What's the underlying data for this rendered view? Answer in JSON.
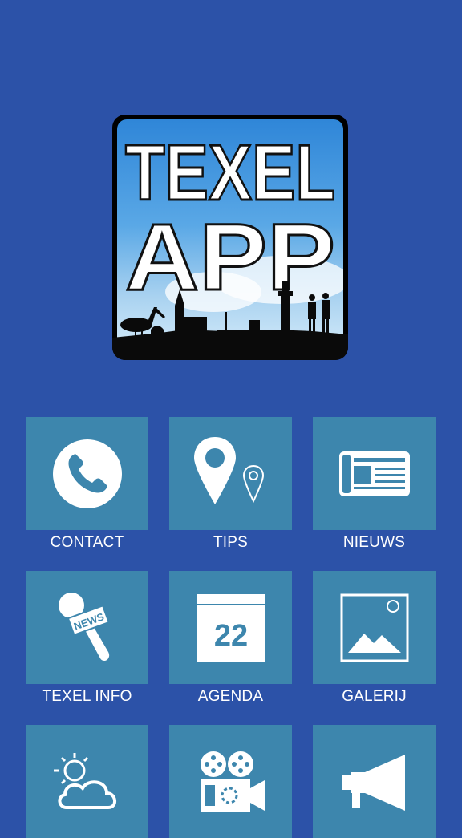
{
  "logo": {
    "line1": "TEXEL",
    "line2": "APP"
  },
  "menu": [
    {
      "label": "CONTACT",
      "icon": "phone-icon"
    },
    {
      "label": "TIPS",
      "icon": "map-pin-icon"
    },
    {
      "label": "NIEUWS",
      "icon": "newspaper-icon"
    },
    {
      "label": "TEXEL INFO",
      "icon": "news-microphone-icon",
      "icon_text": "NEWS"
    },
    {
      "label": "AGENDA",
      "icon": "calendar-icon",
      "icon_text": "22"
    },
    {
      "label": "GALERIJ",
      "icon": "image-gallery-icon"
    },
    {
      "label": "",
      "icon": "weather-icon"
    },
    {
      "label": "",
      "icon": "film-camera-icon"
    },
    {
      "label": "",
      "icon": "megaphone-icon"
    }
  ],
  "colors": {
    "background": "#2c52a8",
    "tile": "#3d86ad",
    "text": "#ffffff"
  }
}
